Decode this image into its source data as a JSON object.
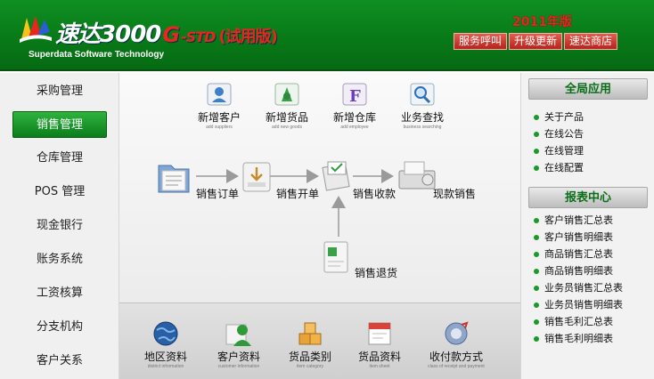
{
  "header": {
    "brand_cn": "速达",
    "brand_num": "3000",
    "brand_g": "G",
    "brand_std": "-STD",
    "brand_trial": "(试用版)",
    "brand_en": "Superdata Software Technology",
    "version": "2011年版",
    "links": [
      "服务呼叫",
      "升级更新",
      "速达商店"
    ]
  },
  "leftnav": {
    "items": [
      "采购管理",
      "销售管理",
      "仓库管理",
      "POS 管理",
      "现金银行",
      "账务系统",
      "工资核算",
      "分支机构",
      "客户关系"
    ],
    "active_index": 1
  },
  "top_actions": [
    {
      "label": "新增客户",
      "sub": "add suppliers",
      "icon": "add-customer-icon"
    },
    {
      "label": "新增货品",
      "sub": "add new goods",
      "icon": "add-goods-icon"
    },
    {
      "label": "新增仓库",
      "sub": "add employee",
      "icon": "add-warehouse-icon"
    },
    {
      "label": "业务查找",
      "sub": "business searching",
      "icon": "search-icon"
    }
  ],
  "flow": {
    "order": "销售订单",
    "invoice": "销售开单",
    "receipt": "销售收款",
    "cash_sale": "现款销售",
    "return": "销售退货"
  },
  "bottom_actions": [
    {
      "label": "地区资料",
      "sub": "district information",
      "icon": "globe-icon"
    },
    {
      "label": "客户资料",
      "sub": "customer information",
      "icon": "customer-icon"
    },
    {
      "label": "货品类别",
      "sub": "item category",
      "icon": "boxes-icon"
    },
    {
      "label": "货品资料",
      "sub": "item sheet",
      "icon": "item-sheet-icon"
    },
    {
      "label": "收付款方式",
      "sub": "class of receipt and payment",
      "icon": "payment-icon"
    }
  ],
  "right": {
    "global_title": "全局应用",
    "global_items": [
      "关于产品",
      "在线公告",
      "在线管理",
      "在线配置"
    ],
    "report_title": "报表中心",
    "report_items": [
      "客户销售汇总表",
      "客户销售明细表",
      "商品销售汇总表",
      "商品销售明细表",
      "业务员销售汇总表",
      "业务员销售明细表",
      "销售毛利汇总表",
      "销售毛利明细表"
    ]
  },
  "colors": {
    "brand_green": "#0f8f22",
    "accent_red": "#e8251e",
    "link_green": "#0a6e17"
  }
}
